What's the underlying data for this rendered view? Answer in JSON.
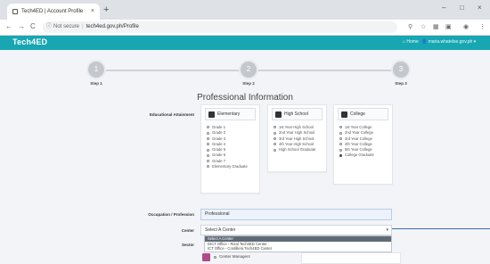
{
  "browser": {
    "tab_title": "Tech4ED | Account Profile",
    "tab_close": "×",
    "new_tab": "+",
    "window_controls": [
      "–",
      "□",
      "×"
    ],
    "not_secure": "Not secure",
    "url": "tech4ed.gov.ph/Profile",
    "info_icon": "ⓘ",
    "nav_icons": [
      "←",
      "→",
      "C"
    ],
    "toolbar_icons": [
      "⚲",
      "☆",
      "▦",
      "▣",
      "◉",
      "⋮"
    ]
  },
  "app": {
    "brand_prefix": "Tech",
    "brand_suffix": "4ED",
    "home": "⌂ Home",
    "user": "👤 maria.whatelse.gov.ph ▾"
  },
  "stepper": {
    "steps": [
      {
        "number": "1",
        "label": "Step 1"
      },
      {
        "number": "2",
        "label": "Step 2"
      },
      {
        "number": "3",
        "label": "Step 3"
      }
    ]
  },
  "section_title": "Professional Information",
  "labels": {
    "educational_attainment": "Educational Attainment",
    "occupation": "Occupation / Profession",
    "center": "Center",
    "sector": "Sector"
  },
  "cards": [
    {
      "title": "Elementary",
      "options": [
        "Grade 1",
        "Grade 2",
        "Grade 3",
        "Grade 4",
        "Grade 5",
        "Grade 6",
        "Grade 7",
        "Elementary Graduate"
      ],
      "selected": -1
    },
    {
      "title": "High School",
      "options": [
        "1st Year High School",
        "2nd Year High School",
        "3rd Year High School",
        "4th Year High School",
        "High School Graduate"
      ],
      "selected": -1
    },
    {
      "title": "College",
      "options": [
        "1st Year College",
        "2nd Year College",
        "3rd Year College",
        "4th Year College",
        "5th Year College",
        "College Graduate"
      ],
      "selected": 5
    }
  ],
  "occupation_value": "Professional",
  "center": {
    "placeholder": "Select A Center",
    "arrow": "▾",
    "dropdown_items": [
      "Select A Center",
      "DICT Office - Rizal Tech4ED Center",
      "ICT Office - Cordillera Tech4ED Center"
    ],
    "highlighted": 0
  },
  "sector_option": "Center Managers",
  "colors": {
    "navbar": "#18a6b3",
    "highlight": "#5f6a75"
  }
}
